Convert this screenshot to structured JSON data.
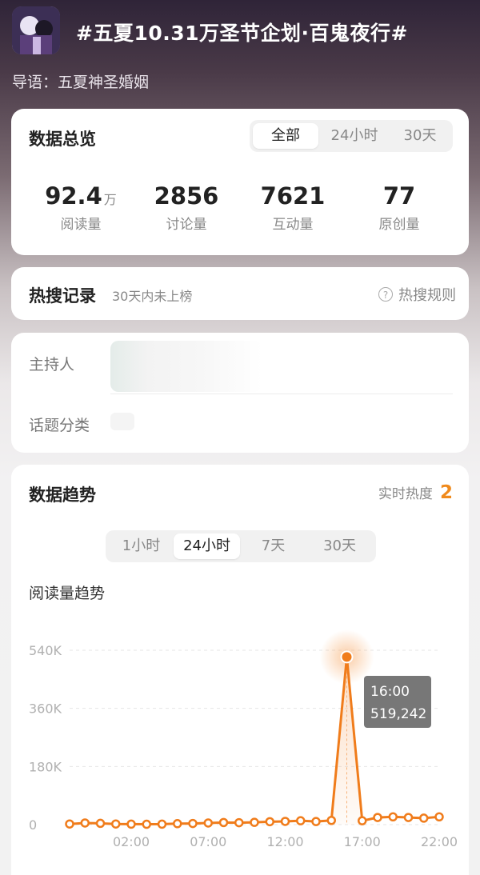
{
  "header": {
    "title": "#五夏10.31万圣节企划·百鬼夜行#",
    "guide": "导语：五夏神圣婚姻"
  },
  "overview": {
    "title": "数据总览",
    "tabs": [
      "全部",
      "24小时",
      "30天"
    ],
    "selected_tab": "全部",
    "stats": [
      {
        "value": "92.4",
        "unit": "万",
        "label": "阅读量"
      },
      {
        "value": "2856",
        "unit": "",
        "label": "讨论量"
      },
      {
        "value": "7621",
        "unit": "",
        "label": "互动量"
      },
      {
        "value": "77",
        "unit": "",
        "label": "原创量"
      }
    ]
  },
  "hot_search": {
    "title": "热搜记录",
    "subtitle": "30天内未上榜",
    "rules_label": "热搜规则",
    "rules_icon": "question-circle-icon"
  },
  "info": {
    "host_label": "主持人",
    "category_label": "话题分类"
  },
  "trend": {
    "title": "数据趋势",
    "realtime_label": "实时热度",
    "realtime_value": "2",
    "tabs": [
      "1小时",
      "24小时",
      "7天",
      "30天"
    ],
    "selected_tab": "24小时",
    "chart_title": "阅读量趋势",
    "accent_color": "#f07c1b"
  },
  "chart_data": {
    "type": "line",
    "ylabel_ticks": [
      "0",
      "180K",
      "360K",
      "540K"
    ],
    "xlabel_ticks": [
      "02:00",
      "07:00",
      "12:00",
      "17:00",
      "22:00"
    ],
    "ylim": [
      0,
      540000
    ],
    "grid": true,
    "x": [
      "22:00",
      "23:00",
      "00:00",
      "01:00",
      "02:00",
      "03:00",
      "04:00",
      "05:00",
      "06:00",
      "07:00",
      "08:00",
      "09:00",
      "10:00",
      "11:00",
      "12:00",
      "13:00",
      "14:00",
      "15:00",
      "16:00",
      "17:00",
      "18:00",
      "19:00",
      "20:00",
      "21:00",
      "22:00"
    ],
    "values": [
      2000,
      5000,
      4000,
      2000,
      1500,
      1200,
      1500,
      3000,
      3500,
      5000,
      6500,
      6000,
      7000,
      9000,
      10000,
      12000,
      9500,
      13000,
      519242,
      12000,
      22000,
      24000,
      22000,
      20000,
      24000
    ],
    "tooltip": {
      "time": "16:00",
      "value": "519,242"
    }
  }
}
